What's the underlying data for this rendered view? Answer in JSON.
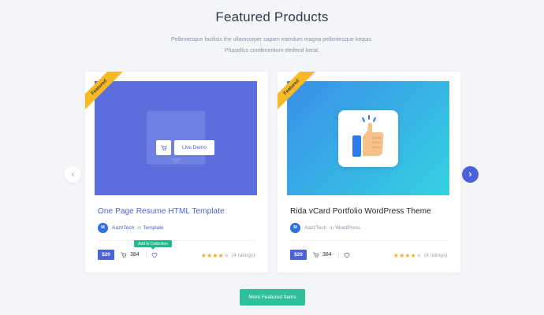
{
  "section": {
    "title": "Featured Products",
    "description": "Pellentesque facilisis the ullamcorper sapien interdum magna pellentesque kequis. Phasellus condimentum eleifend kerat."
  },
  "colors": {
    "primary": "#4c62d8",
    "accent_green": "#2dc09b",
    "ribbon": "#f7b924",
    "star": "#f7a81e"
  },
  "products": [
    {
      "ribbon": "Featured",
      "title": "One Page Resume HTML Template",
      "author_initial": "M",
      "author": "AazzTech",
      "in_label": "in",
      "category": "Template",
      "price": "$20",
      "sales": "384",
      "rating": 4,
      "ratings_label": "(4 ratings)",
      "live_demo_label": "Live Demo",
      "tooltip": "Add to Collection",
      "thumbnail": "blue-solid-preview",
      "icons": [
        "cart-icon",
        "heart-icon"
      ]
    },
    {
      "ribbon": "Featured",
      "title": "Rida vCard Portfolio WordPress Theme",
      "author_initial": "M",
      "author": "AazzTech",
      "in_label": "in",
      "category": "WordPress",
      "price": "$20",
      "sales": "384",
      "rating": 4,
      "ratings_label": "(4 ratings)",
      "thumbnail": "thumbs-up-preview",
      "icons": [
        "thumbs-up-icon",
        "cart-icon",
        "heart-icon"
      ]
    }
  ],
  "navigation": {
    "prev_icon": "chevron-left-icon",
    "next_icon": "chevron-right-icon"
  },
  "more_button": "More Featured Items"
}
